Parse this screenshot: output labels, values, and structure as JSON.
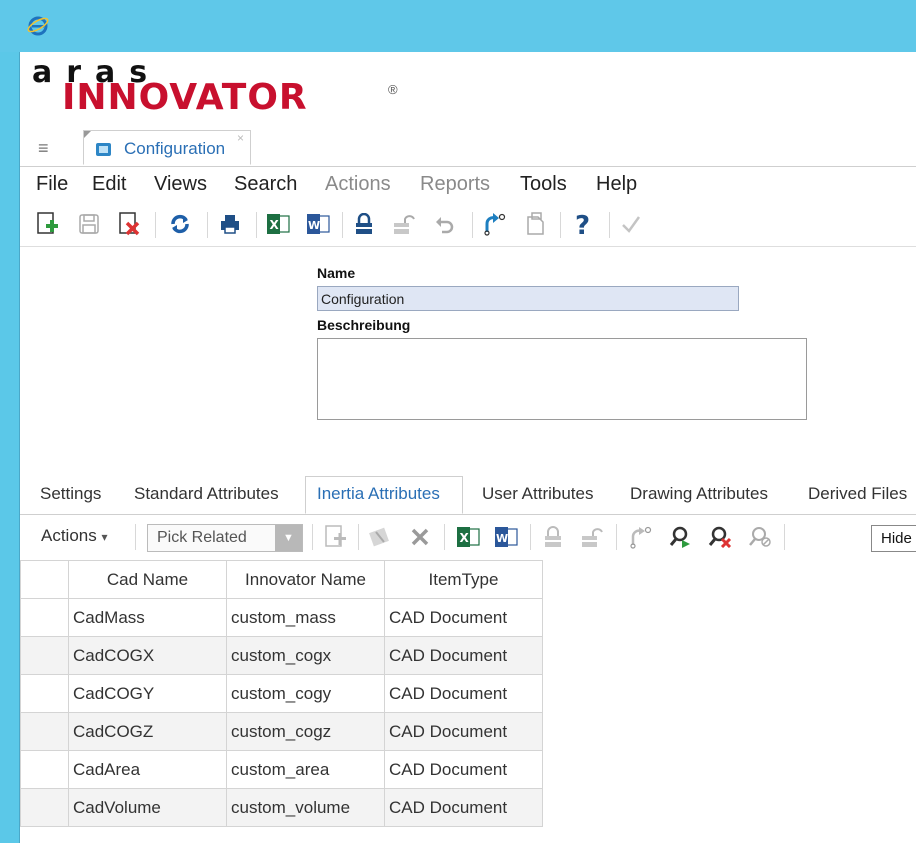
{
  "logo": {
    "top": "aras",
    "bottom": "INNOVATOR",
    "reg": "®"
  },
  "doc_tab": {
    "label": "Configuration",
    "close": "×"
  },
  "menu": [
    {
      "label": "File",
      "enabled": true
    },
    {
      "label": "Edit",
      "enabled": true
    },
    {
      "label": "Views",
      "enabled": true
    },
    {
      "label": "Search",
      "enabled": true
    },
    {
      "label": "Actions",
      "enabled": false
    },
    {
      "label": "Reports",
      "enabled": false
    },
    {
      "label": "Tools",
      "enabled": true
    },
    {
      "label": "Help",
      "enabled": true
    }
  ],
  "toolbar_icons": [
    "new-item-icon",
    "save-icon",
    "discard-icon",
    "refresh-icon",
    "print-icon",
    "excel-icon",
    "word-icon",
    "lock-icon",
    "unlock-icon",
    "undo-icon",
    "promote-icon",
    "copy-icon",
    "help-icon",
    "done-icon"
  ],
  "form": {
    "name_label": "Name",
    "name_value": "Configuration",
    "description_label": "Beschreibung",
    "description_value": ""
  },
  "relationship_tabs": [
    {
      "label": "Settings",
      "active": false
    },
    {
      "label": "Standard Attributes",
      "active": false
    },
    {
      "label": "Inertia Attributes",
      "active": true
    },
    {
      "label": "User Attributes",
      "active": false
    },
    {
      "label": "Drawing Attributes",
      "active": false
    },
    {
      "label": "Derived Files",
      "active": false
    }
  ],
  "rel_toolbar": {
    "actions_label": "Actions",
    "actions_arrow": "▾",
    "pick_label": "Pick Related",
    "hide_label": "Hide"
  },
  "grid": {
    "columns": [
      "Cad Name",
      "Innovator Name",
      "ItemType"
    ],
    "rows": [
      [
        "CadMass",
        "custom_mass",
        "CAD Document"
      ],
      [
        "CadCOGX",
        "custom_cogx",
        "CAD Document"
      ],
      [
        "CadCOGY",
        "custom_cogy",
        "CAD Document"
      ],
      [
        "CadCOGZ",
        "custom_cogz",
        "CAD Document"
      ],
      [
        "CadArea",
        "custom_area",
        "CAD Document"
      ],
      [
        "CadVolume",
        "custom_volume",
        "CAD Document"
      ]
    ]
  },
  "colors": {
    "accent": "#2a6fb5",
    "brand_red": "#c8102e",
    "titlebar": "#5fc8e9"
  }
}
